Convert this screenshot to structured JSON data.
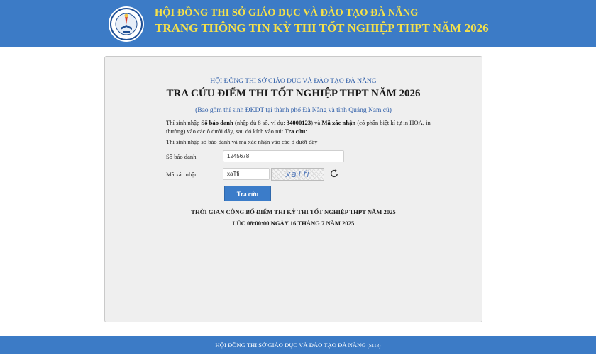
{
  "colors": {
    "header_bg": "#3c7bc6",
    "header_text": "#f5e14a",
    "link_blue": "#2d5da8",
    "button_bg": "#3b7cc9",
    "panel_bg": "#efefef"
  },
  "header": {
    "logo_icon": "education-seal-icon",
    "line1": "HỘI ĐỒNG THI SỞ GIÁO DỤC VÀ ĐÀO TẠO ĐÀ NẴNG",
    "line2": "TRANG THÔNG TIN KỲ THI TỐT NGHIỆP THPT NĂM 2026"
  },
  "panel": {
    "org": "HỘI ĐỒNG THI SỞ GIÁO DỤC VÀ ĐÀO TẠO ĐÀ NẴNG",
    "title": "TRA CỨU ĐIỂM THI TỐT NGHIỆP THPT NĂM 2026",
    "subnote": "(Bao gồm thí sinh ĐKDT tại thành phố Đà Nẵng và tỉnh Quảng Nam cũ)",
    "instructions": {
      "t1": "Thí sinh nhập ",
      "b1": "Số báo danh",
      "t2": " (nhập đủ 8 số, ví dụ: ",
      "b2": "34000123",
      "t3": ") và ",
      "b3": "Mã xác nhận",
      "t4": " (có phân biệt kí tự in HOA, in thường) vào các ô dưới đây, sau đó kích vào nút ",
      "b4": "Tra cứu",
      "t5": ":"
    },
    "instructions2": "Thí sinh nhập số báo danh và mã xác nhận vào các ô dưới đây",
    "form": {
      "sbd_label": "Số báo danh",
      "sbd_value": "1245678",
      "captcha_label": "Mã xác nhận",
      "captcha_value": "xaTfi",
      "captcha_image_text": "xaTfi",
      "refresh_icon": "refresh-icon",
      "submit_label": "Tra cứu"
    },
    "announce_line1": "THỜI GIAN CÔNG BỐ ĐIỂM THI KỲ THI TỐT NGHIỆP THPT NĂM 2025",
    "announce_line2": "LÚC 08:00:00 NGÀY 16 THÁNG 7 NĂM 2025"
  },
  "footer": {
    "text": "HỘI ĐỒNG THI SỞ GIÁO DỤC VÀ ĐÀO TẠO ĐÀ NẴNG",
    "code": "(S118)"
  }
}
